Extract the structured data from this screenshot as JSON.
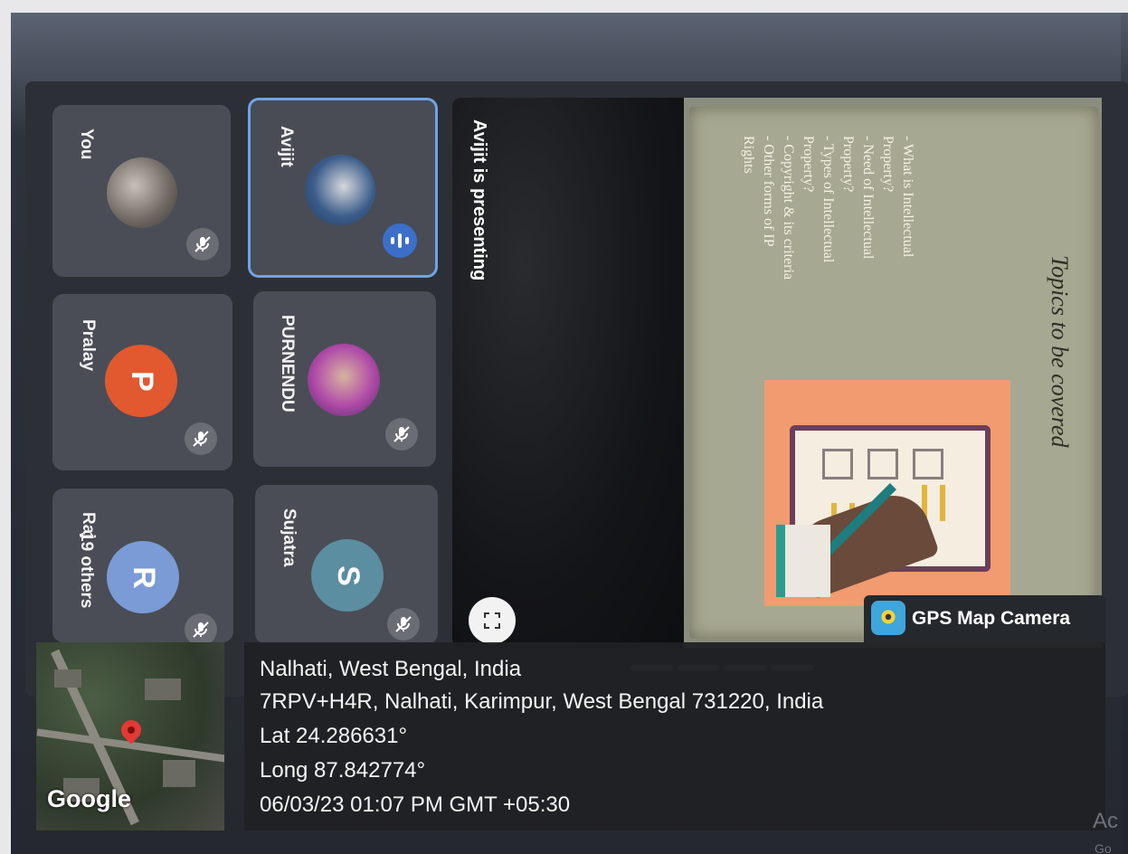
{
  "meeting": {
    "presenting_label": "Avijit is presenting",
    "participants": [
      {
        "name": "You",
        "avatar": "photo-avatar",
        "muted": true
      },
      {
        "name": "Avijit",
        "avatar": "photo-avatar",
        "speaking": true
      },
      {
        "name": "Pralay",
        "initial": "P",
        "avatar_color": "#e2582f",
        "muted": true
      },
      {
        "name": "PURNENDU",
        "avatar": "photo-avatar",
        "muted": true
      },
      {
        "name": "Raj",
        "initial": "R",
        "avatar_color": "#7b9bd6",
        "muted": true
      },
      {
        "name": "Sujatra",
        "initial": "S",
        "avatar_color": "#5a8ea0",
        "muted": true
      }
    ],
    "others_label": "19 others"
  },
  "slide": {
    "title": "Topics to be covered",
    "bullets": [
      "- What is Intellectual",
      "Property?",
      "- Need of Intellectual",
      "Property?",
      "- Types of Intellectual",
      "Property?",
      "- Copyright & its criteria",
      "- Other forms of IP",
      "Rights"
    ]
  },
  "gps": {
    "badge_label": "GPS Map Camera",
    "map_label": "Google",
    "line1": "Nalhati, West Bengal, India",
    "line2": "7RPV+H4R, Nalhati, Karimpur, West Bengal 731220, India",
    "line3": "Lat 24.286631°",
    "line4": "Long 87.842774°",
    "line5": "06/03/23 01:07 PM GMT +05:30"
  },
  "watermark": {
    "line1": "Ac",
    "line2": "Go"
  },
  "colors": {
    "active_border": "#6fa3e8",
    "speaking": "#3b6fc9",
    "slide_art": "#f29a70"
  },
  "icons": {
    "mic_off": "mic-off-icon",
    "fullscreen": "fullscreen-icon",
    "pin": "map-pin-icon"
  }
}
